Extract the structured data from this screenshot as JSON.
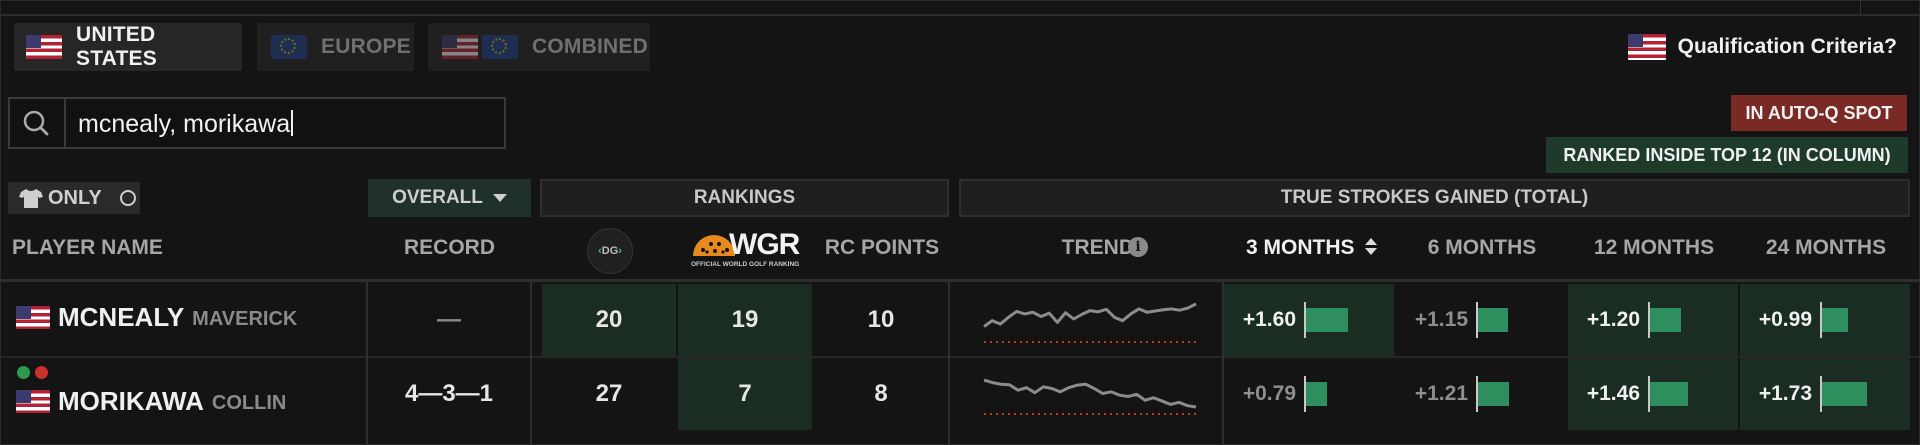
{
  "tabs": [
    {
      "label": "UNITED STATES",
      "flags": [
        "us"
      ],
      "active": true
    },
    {
      "label": "EUROPE",
      "flags": [
        "eu"
      ],
      "active": false
    },
    {
      "label": "COMBINED",
      "flags": [
        "us",
        "eu"
      ],
      "active": false
    }
  ],
  "qualification_label": "Qualification Criteria?",
  "search": {
    "value": "mcnealy, morikawa"
  },
  "legend": {
    "auto_q": "IN AUTO-Q SPOT",
    "top12": "RANKED INSIDE TOP 12 (IN COLUMN)"
  },
  "filters": {
    "only_label": "ONLY",
    "overall_label": "OVERALL"
  },
  "groups": {
    "rankings": "RANKINGS",
    "true_sg": "TRUE STROKES GAINED (TOTAL)"
  },
  "columns": {
    "player": "PLAYER NAME",
    "record": "RECORD",
    "dg_logo": "DG",
    "owgr_logo": "WGR",
    "owgr_sub": "OFFICIAL WORLD GOLF RANKING",
    "rc_points": "RC POINTS",
    "trends": "TRENDS",
    "m3": "3 MONTHS",
    "m6": "6 MONTHS",
    "m12": "12 MONTHS",
    "m24": "24 MONTHS"
  },
  "colors": {
    "highlight": "#1b2c22",
    "bar": "#2f8e5e",
    "auto_q": "#7a2a24",
    "top12": "#1e3a2b"
  },
  "players": [
    {
      "last": "MCNEALY",
      "first": "MAVERICK",
      "flag": "us",
      "record": "—",
      "dg": "20",
      "owgr": "19",
      "rc": "10",
      "sg": [
        "+1.60",
        "+1.15",
        "+1.20",
        "+0.99"
      ],
      "sg_values": [
        1.6,
        1.15,
        1.2,
        0.99
      ],
      "trend": [
        3.2,
        4.6,
        3.8,
        5.4,
        6.8,
        6.2,
        6.6,
        5.6,
        6.4,
        4.2,
        6.5,
        5.0,
        6.1,
        7.0,
        6.7,
        7.3,
        5.4,
        4.6,
        6.2,
        7.4,
        6.6,
        6.9,
        7.2,
        7.4,
        7.1,
        7.6,
        8.6
      ],
      "status": []
    },
    {
      "last": "MORIKAWA",
      "first": "COLLIN",
      "flag": "us",
      "record": "4—3—1",
      "dg": "27",
      "owgr": "7",
      "rc": "8",
      "sg": [
        "+0.79",
        "+1.21",
        "+1.46",
        "+1.73"
      ],
      "sg_values": [
        0.79,
        1.21,
        1.46,
        1.73
      ],
      "trend": [
        7.6,
        7.0,
        6.6,
        6.5,
        5.2,
        5.8,
        4.6,
        6.0,
        5.6,
        4.8,
        5.8,
        6.4,
        6.6,
        5.6,
        4.4,
        4.8,
        4.0,
        3.7,
        4.2,
        2.8,
        3.4,
        2.6,
        1.8,
        2.3,
        1.5,
        1.2
      ],
      "status": [
        "green",
        "red"
      ]
    }
  ]
}
